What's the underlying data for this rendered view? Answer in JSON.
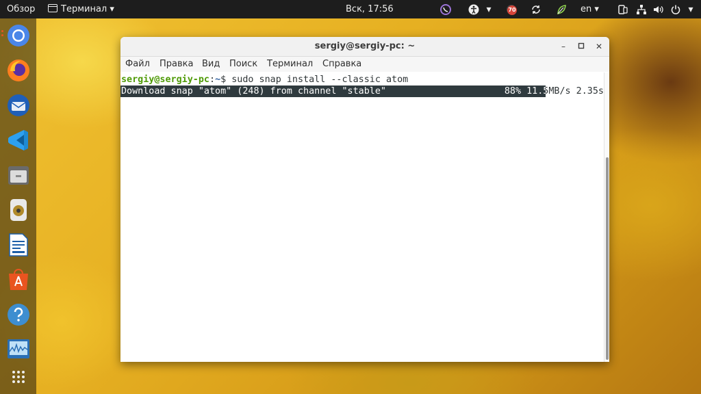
{
  "topbar": {
    "overview": "Обзор",
    "app_name": "Терминал ▾",
    "clock": "Вск, 17:56",
    "notification_count": "70",
    "language": "en ▾"
  },
  "dock": {
    "items": [
      "chromium",
      "firefox",
      "thunderbird",
      "vscode",
      "files",
      "rhythmbox",
      "libreoffice-writer",
      "software-center",
      "help",
      "system-monitor",
      "show-applications"
    ]
  },
  "window": {
    "title": "sergiy@sergiy-pc: ~",
    "menu": [
      "Файл",
      "Правка",
      "Вид",
      "Поиск",
      "Терминал",
      "Справка"
    ]
  },
  "terminal": {
    "user_host": "sergiy@sergiy-pc",
    "path_sep": ":",
    "path": "~",
    "prompt_symbol": "$ ",
    "command": "sudo snap install --classic atom",
    "progress_text": "Download snap \"atom\" (248) from channel \"stable\"",
    "progress_stats": "88% 11.5MB/s 2.35s",
    "progress_fraction": 0.88
  },
  "colors": {
    "prompt_user": "#4e9a06",
    "prompt_path": "#3465a4",
    "progress_fill": "#2f3a3e",
    "accent": "#e95420"
  }
}
